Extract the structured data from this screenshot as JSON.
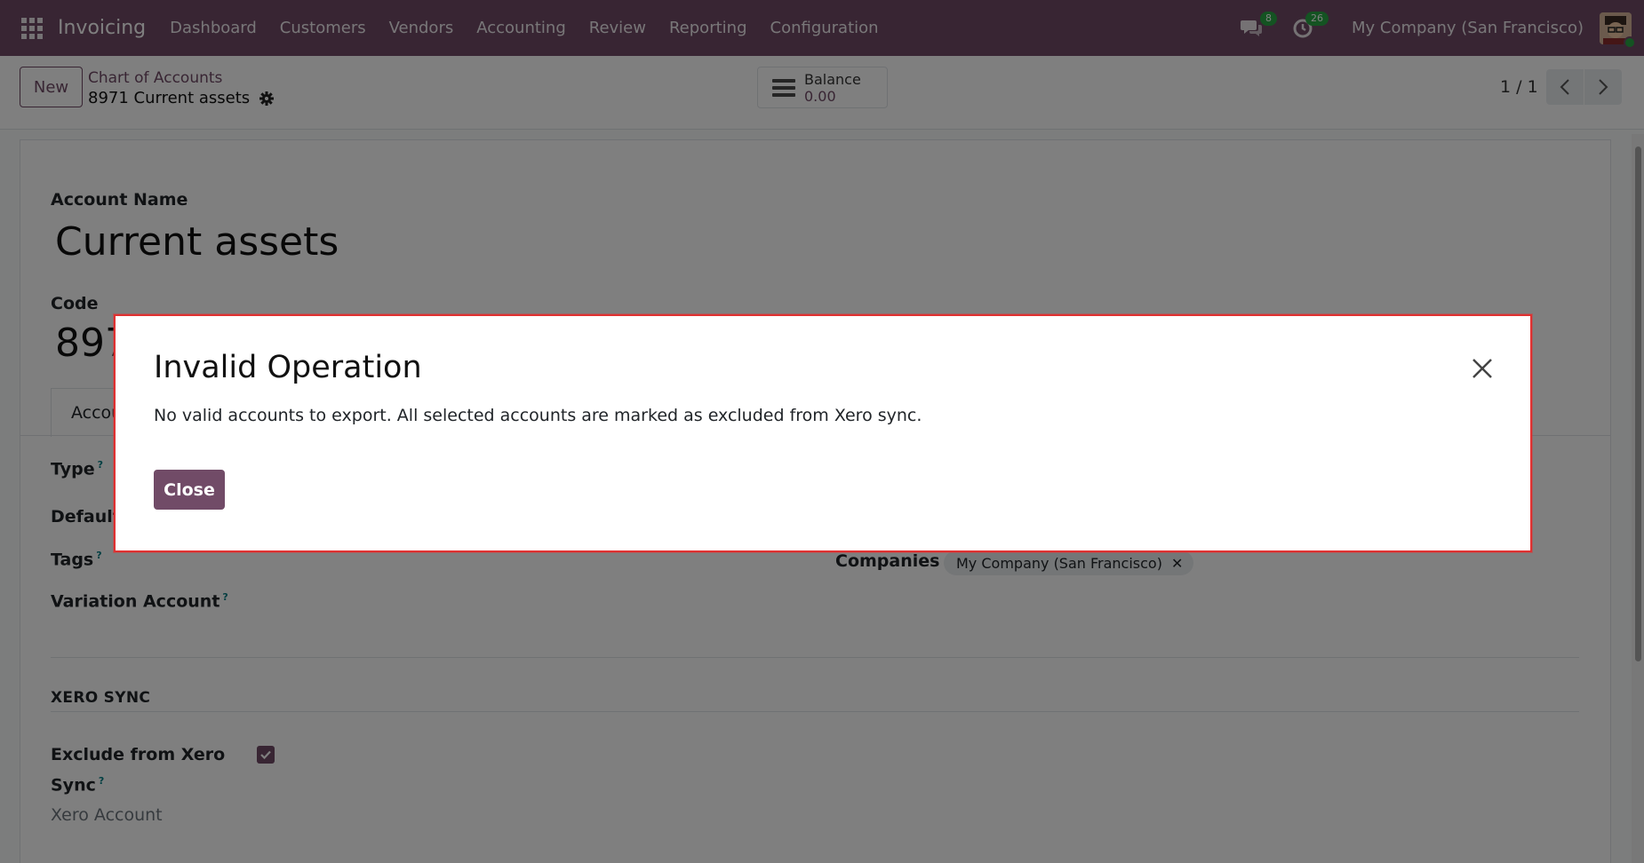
{
  "navbar": {
    "brand": "Invoicing",
    "menu": [
      "Dashboard",
      "Customers",
      "Vendors",
      "Accounting",
      "Review",
      "Reporting",
      "Configuration"
    ],
    "messages_count": "8",
    "activities_count": "26",
    "company": "My Company (San Francisco)"
  },
  "control_panel": {
    "new_label": "New",
    "breadcrumb": "Chart of Accounts",
    "record_title": "8971 Current assets",
    "balance_label": "Balance",
    "balance_value": "0.00",
    "pager": "1 / 1"
  },
  "form": {
    "account_name_label": "Account Name",
    "account_name_value": "Current assets",
    "code_label": "Code",
    "code_value": "8971",
    "tab_label": "Accounting",
    "type_label": "Type",
    "default_label": "Default",
    "tags_label": "Tags",
    "variation_label": "Variation Account",
    "help_mark": "?",
    "companies_label": "Companies",
    "company_tag": "My Company (San Francisco)",
    "tag_remove": "✕",
    "xero_section": "XERO SYNC",
    "exclude_label": "Exclude from Xero Sync",
    "exclude_checked": true,
    "xero_account_label": "Xero Account"
  },
  "dialog": {
    "title": "Invalid Operation",
    "message": "No valid accounts to export. All selected accounts are marked as excluded from Xero sync.",
    "close_label": "Close"
  },
  "colors": {
    "brand": "#714b67",
    "badge": "#28a745",
    "dialog_border": "#e03131"
  }
}
